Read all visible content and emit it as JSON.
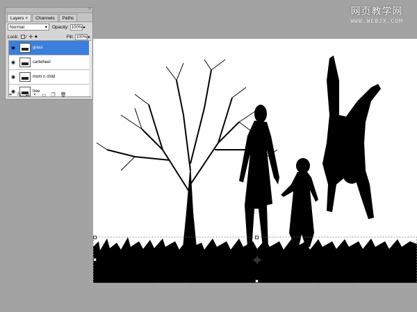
{
  "watermark": {
    "title": "网页教学网",
    "url": "WWW.WEBJX.COM"
  },
  "layers_panel": {
    "tabs": [
      {
        "label": "Layers ×",
        "active": true
      },
      {
        "label": "Channels",
        "active": false
      },
      {
        "label": "Paths",
        "active": false
      }
    ],
    "blend_mode": "Normal",
    "opacity_label": "Opacity:",
    "opacity_value": "100%",
    "lock_label": "Lock:",
    "fill_label": "Fill:",
    "fill_value": "100%",
    "layers": [
      {
        "name": "grass",
        "selected": true,
        "visible": true
      },
      {
        "name": "cartwheel",
        "selected": false,
        "visible": true
      },
      {
        "name": "mom n child",
        "selected": false,
        "visible": true
      },
      {
        "name": "tree",
        "selected": false,
        "visible": true
      }
    ],
    "footer_icons": [
      "link-icon",
      "fx-icon",
      "mask-icon",
      "adjustment-icon",
      "folder-icon",
      "new-layer-icon",
      "trash-icon"
    ]
  },
  "colors": {
    "selection": "#3a7fdc",
    "workspace": "#a3a3a3",
    "silhouette": "#000000"
  }
}
